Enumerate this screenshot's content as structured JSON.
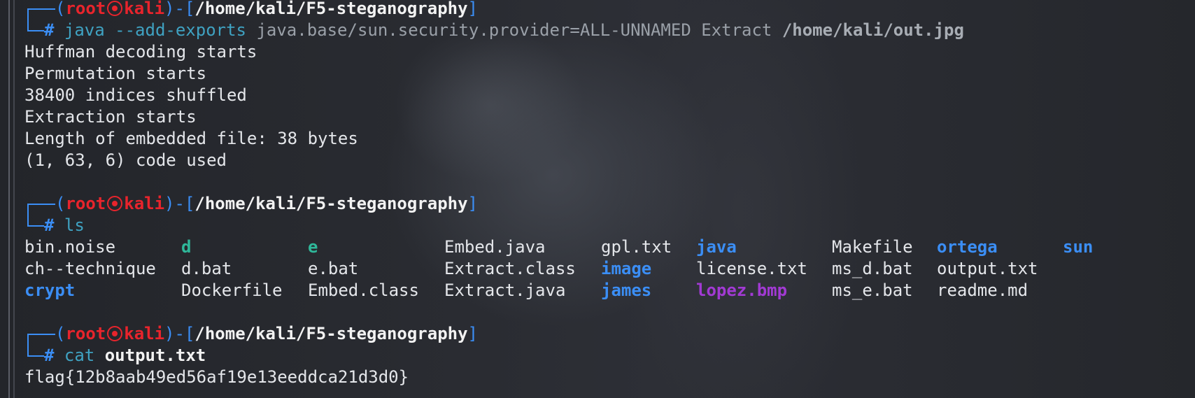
{
  "terminal": {
    "prompt": {
      "user": "root",
      "host": "kali",
      "open_paren": "(",
      "close_paren": ")",
      "dash_bracket": "-[",
      "close_bracket": "]",
      "symbol": "#",
      "cwd": "/home/kali/F5-steganography"
    },
    "block1": {
      "cmd_java": "java",
      "cmd_opt": "--add-exports",
      "cmd_arg": "java.base/sun.security.provider=ALL-UNNAMED Extract",
      "cmd_path": "/home/kali/out.jpg",
      "output": [
        "Huffman decoding starts",
        "Permutation starts",
        "38400 indices shuffled",
        "Extraction starts",
        "Length of embedded file: 38 bytes",
        "(1, 63, 6) code used"
      ]
    },
    "block2": {
      "cmd": "ls",
      "files": [
        {
          "name": "bin.noise",
          "kind": "file"
        },
        {
          "name": "ch--technique",
          "kind": "file"
        },
        {
          "name": "crypt",
          "kind": "dir"
        },
        {
          "name": "d",
          "kind": "exec"
        },
        {
          "name": "d.bat",
          "kind": "file"
        },
        {
          "name": "Dockerfile",
          "kind": "file"
        },
        {
          "name": "e",
          "kind": "exec"
        },
        {
          "name": "e.bat",
          "kind": "file"
        },
        {
          "name": "Embed.class",
          "kind": "file"
        },
        {
          "name": "Embed.java",
          "kind": "file"
        },
        {
          "name": "Extract.class",
          "kind": "file"
        },
        {
          "name": "Extract.java",
          "kind": "file"
        },
        {
          "name": "gpl.txt",
          "kind": "file"
        },
        {
          "name": "image",
          "kind": "dir"
        },
        {
          "name": "james",
          "kind": "dir"
        },
        {
          "name": "java",
          "kind": "dir"
        },
        {
          "name": "license.txt",
          "kind": "file"
        },
        {
          "name": "lopez.bmp",
          "kind": "img"
        },
        {
          "name": "Makefile",
          "kind": "file"
        },
        {
          "name": "ms_d.bat",
          "kind": "file"
        },
        {
          "name": "ms_e.bat",
          "kind": "file"
        },
        {
          "name": "ortega",
          "kind": "dir"
        },
        {
          "name": "output.txt",
          "kind": "file"
        },
        {
          "name": "readme.md",
          "kind": "file"
        },
        {
          "name": "sun",
          "kind": "dir"
        }
      ]
    },
    "block3": {
      "cmd": "cat",
      "arg": "output.txt",
      "output": "flag{12b8aab49ed56af19e13eeddca21d3d0}"
    },
    "colors": {
      "prompt_frame": "#3b8ef5",
      "user_host": "#e8242c",
      "directory": "#3b8ef5",
      "executable": "#2fb89a",
      "image_file": "#a23ad4"
    }
  }
}
